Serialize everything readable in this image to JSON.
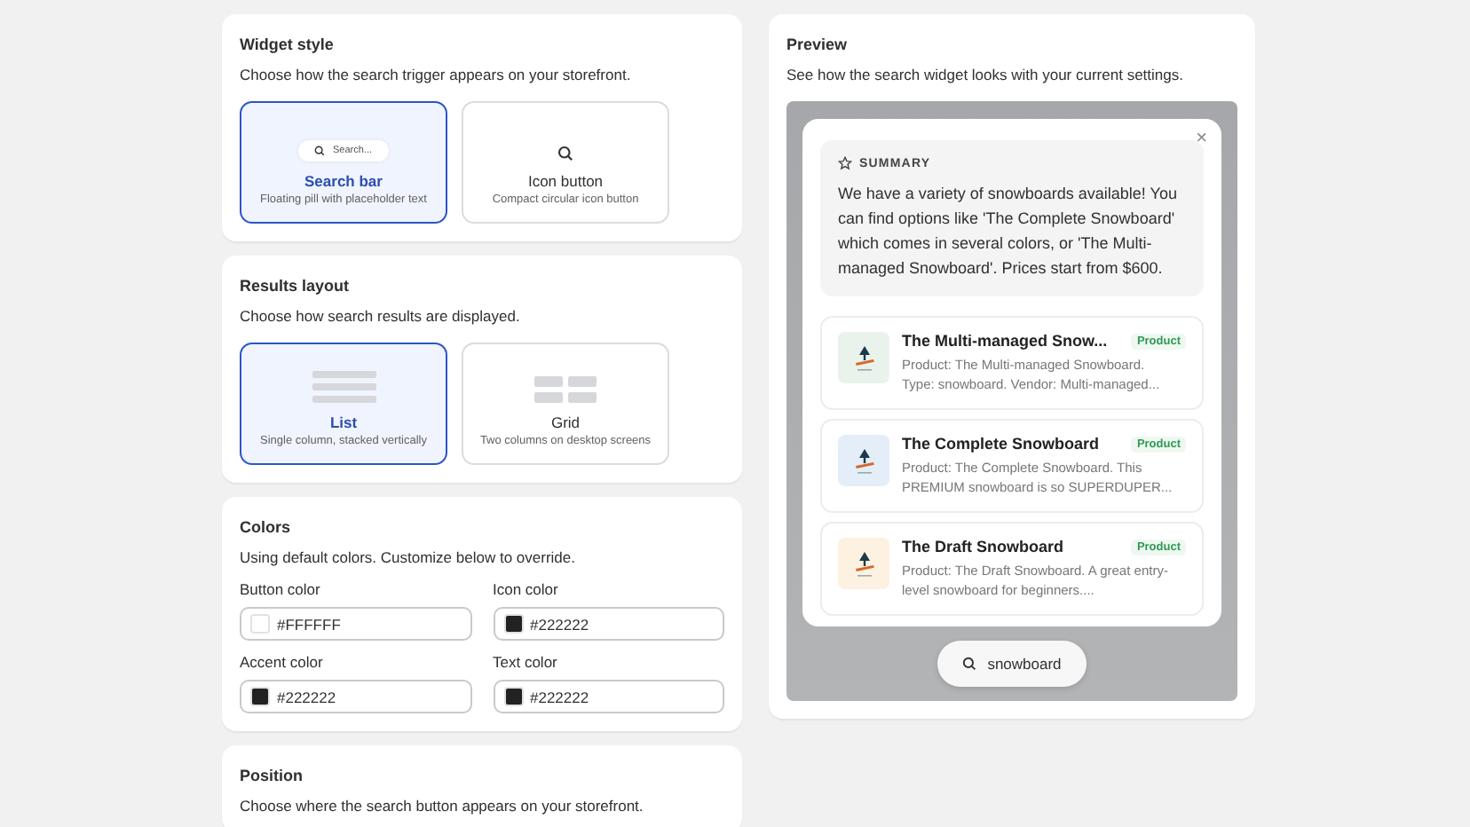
{
  "widget_style": {
    "title": "Widget style",
    "description": "Choose how the search trigger appears on your storefront.",
    "options": [
      {
        "kind": "search_bar",
        "label": "Search bar",
        "sublabel": "Floating pill with placeholder text",
        "preview_text": "Search...",
        "selected": true
      },
      {
        "kind": "icon_button",
        "label": "Icon button",
        "sublabel": "Compact circular icon button",
        "selected": false
      }
    ]
  },
  "results_layout": {
    "title": "Results layout",
    "description": "Choose how search results are displayed.",
    "options": [
      {
        "kind": "list",
        "label": "List",
        "sublabel": "Single column, stacked vertically",
        "selected": true
      },
      {
        "kind": "grid",
        "label": "Grid",
        "sublabel": "Two columns on desktop screens",
        "selected": false
      }
    ]
  },
  "colors": {
    "title": "Colors",
    "description": "Using default colors. Customize below to override.",
    "fields": [
      {
        "label": "Button color",
        "value": "#FFFFFF",
        "color": "#ffffff"
      },
      {
        "label": "Icon color",
        "value": "#222222",
        "color": "#222222"
      },
      {
        "label": "Accent color",
        "value": "#222222",
        "color": "#222222"
      },
      {
        "label": "Text color",
        "value": "#222222",
        "color": "#222222"
      }
    ]
  },
  "position": {
    "title": "Position",
    "description": "Choose where the search button appears on your storefront."
  },
  "preview": {
    "title": "Preview",
    "description": "See how the search widget looks with your current settings.",
    "close": "×",
    "summary": {
      "heading": "SUMMARY",
      "text": "We have a variety of snowboards available! You can find options like 'The Complete Snowboard' which comes in several colors, or 'The Multi-managed Snowboard'. Prices start from $600."
    },
    "results": [
      {
        "title": "The Multi-managed Snow...",
        "badge": "Product",
        "description": "Product: The Multi-managed Snowboard. Type: snowboard. Vendor: Multi-managed...",
        "color": "#e9f3ec"
      },
      {
        "title": "The Complete Snowboard",
        "badge": "Product",
        "description": "Product: The Complete Snowboard. This PREMIUM snowboard is so SUPERDUPER...",
        "color": "#e4eef8"
      },
      {
        "title": "The Draft Snowboard",
        "badge": "Product",
        "description": "Product: The Draft Snowboard. A great entry-level snowboard for beginners....",
        "color": "#fdf1e1"
      }
    ],
    "search_value": "snowboard"
  }
}
